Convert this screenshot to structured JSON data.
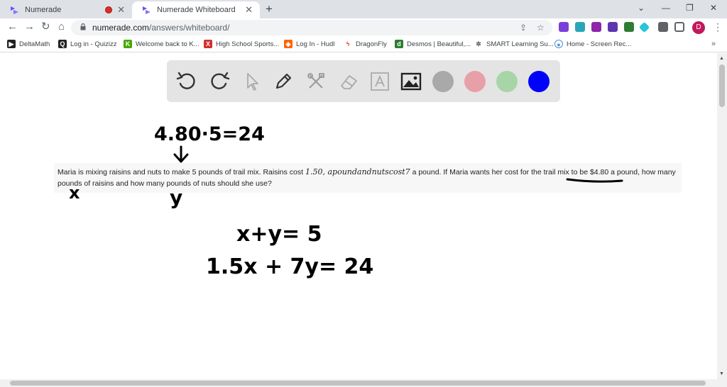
{
  "browser": {
    "tabs": [
      {
        "title": "Numerade",
        "active": false,
        "recording": true
      },
      {
        "title": "Numerade Whiteboard",
        "active": true
      }
    ],
    "address": {
      "host": "numerade.com",
      "path": "/answers/whiteboard/"
    },
    "profile_initial": "D",
    "bookmarks": [
      {
        "label": "DeltaMath",
        "icon": "deltamath-icon",
        "color": "#222222"
      },
      {
        "label": "Log in - Quizizz",
        "icon": "quizizz-icon",
        "color": "#222222"
      },
      {
        "label": "Welcome back to K...",
        "icon": "kahoot-icon",
        "color": "#46a800"
      },
      {
        "label": "High School Sports...",
        "icon": "xello-icon",
        "color": "#d32f2f"
      },
      {
        "label": "Log In - Hudl",
        "icon": "hudl-icon",
        "color": "#ff6300"
      },
      {
        "label": "DragonFly",
        "icon": "dragonfly-icon",
        "color": "#e53935"
      },
      {
        "label": "Desmos | Beautiful,...",
        "icon": "desmos-icon",
        "color": "#2e7d32"
      },
      {
        "label": "SMART Learning Su...",
        "icon": "smart-icon",
        "color": "#555555"
      },
      {
        "label": "Home - Screen Rec...",
        "icon": "screencastify-icon",
        "color": "#4a90d9"
      }
    ]
  },
  "whiteboard": {
    "tools": [
      "undo-icon",
      "redo-icon",
      "select-icon",
      "pen-icon",
      "tools-icon",
      "eraser-icon",
      "text-icon",
      "image-icon"
    ],
    "colors": [
      "#a9a9a9",
      "#e8a0a8",
      "#a8d5a8",
      "#0000ff"
    ],
    "question": {
      "part1": "Maria is mixing raisins and nuts to make 5 pounds of trail mix. Raisins cost ",
      "math": "1.50, apoundandnutscost7",
      "part2": " a pound. If Maria wants her cost for the trail mix to be $4.80 a pound, how many pounds of raisins and how many pounds of nuts should she use?"
    },
    "handwriting": {
      "top_equation": "4.80·5=24",
      "var_x": "x",
      "var_y": "y",
      "eq1": "x+y= 5",
      "eq2": "1.5x + 7y= 24"
    }
  }
}
